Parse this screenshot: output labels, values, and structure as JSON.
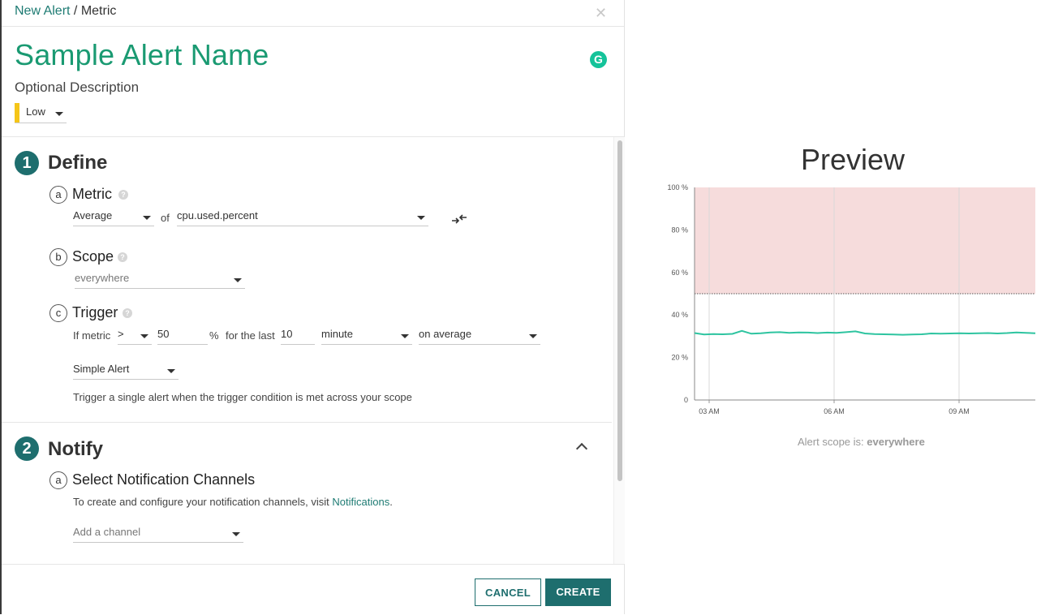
{
  "breadcrumb": {
    "link": "New Alert",
    "separator": " / ",
    "current": "Metric"
  },
  "alert": {
    "name": "Sample Alert Name",
    "description": "Optional Description",
    "severity": "Low",
    "severity_color": "#f5c518"
  },
  "define": {
    "number": "1",
    "title": "Define",
    "metric": {
      "letter": "a",
      "title": "Metric",
      "aggregation": "Average",
      "of_label": "of",
      "metric_name": "cpu.used.percent"
    },
    "scope": {
      "letter": "b",
      "title": "Scope",
      "value": "everywhere"
    },
    "trigger": {
      "letter": "c",
      "title": "Trigger",
      "if_label": "If metric",
      "operator": ">",
      "threshold": "50",
      "unit": "%",
      "for_label": "for the last",
      "duration": "10",
      "duration_unit": "minute",
      "aggregation": "on average",
      "alert_type": "Simple Alert",
      "help_text": "Trigger a single alert when the trigger condition is met across your scope"
    }
  },
  "notify": {
    "number": "2",
    "title": "Notify",
    "channels": {
      "letter": "a",
      "title": "Select Notification Channels",
      "info_prefix": "To create and configure your notification channels, visit ",
      "info_link": "Notifications",
      "info_suffix": ".",
      "placeholder": "Add a channel"
    }
  },
  "footer": {
    "cancel_label": "CANCEL",
    "create_label": "CREATE"
  },
  "preview": {
    "title": "Preview",
    "scope_prefix": "Alert scope is: ",
    "scope_value": "everywhere"
  },
  "colors": {
    "accent": "#1e6e6e",
    "title_green": "#1a9a72",
    "series": "#2ec4a0",
    "threshold_fill": "#f6dcdc"
  },
  "chart_data": {
    "type": "line",
    "y_ticks": [
      "0",
      "20 %",
      "40 %",
      "60 %",
      "80 %",
      "100 %"
    ],
    "x_ticks": [
      "03 AM",
      "06 AM",
      "09 AM"
    ],
    "ylim": [
      0,
      100
    ],
    "threshold": 50,
    "series": [
      {
        "values": [
          31.5,
          30.8,
          31,
          30.9,
          31.1,
          32.5,
          31.2,
          31.4,
          31.8,
          31.9,
          31.6,
          31.8,
          31.7,
          31.5,
          31.7,
          31.6,
          31.9,
          32.3,
          31.3,
          31,
          30.9,
          30.8,
          30.7,
          30.8,
          30.9,
          31.3,
          31.2,
          31.3,
          31.4,
          31.3,
          31.4,
          31.5,
          31.3,
          31.5,
          31.8,
          31.6,
          31.4
        ]
      }
    ]
  }
}
